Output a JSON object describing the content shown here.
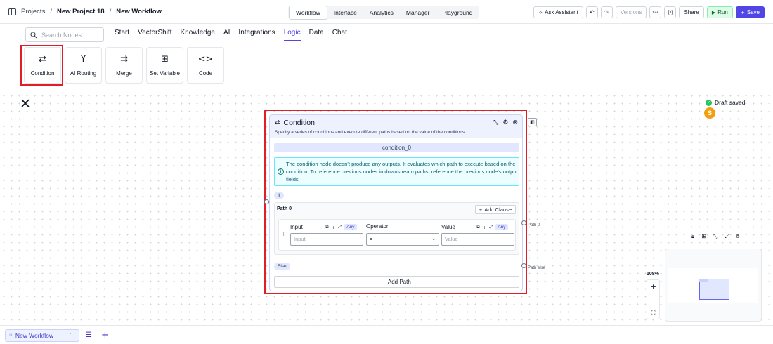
{
  "breadcrumb": {
    "projects": "Projects",
    "project": "New Project 18",
    "workflow": "New Workflow",
    "separator": "/"
  },
  "top_tabs": [
    "Workflow",
    "Interface",
    "Analytics",
    "Manager",
    "Playground"
  ],
  "top_tabs_active": "Workflow",
  "actions": {
    "ask_assistant": "Ask Assistant",
    "undo_glyph": "↶",
    "redo_glyph": "↷",
    "versions": "Versions",
    "code_glyph": "</>",
    "embed_glyph": "[x]",
    "share": "Share",
    "run": "Run",
    "save": "Save"
  },
  "search": {
    "placeholder": "Search Nodes"
  },
  "categories": [
    "Start",
    "VectorShift",
    "Knowledge",
    "AI",
    "Integrations",
    "Logic",
    "Data",
    "Chat"
  ],
  "active_category": "Logic",
  "logic_nodes": [
    {
      "label": "Condition",
      "icon": "condition-icon",
      "glyph": "⇄"
    },
    {
      "label": "AI Routing",
      "icon": "routing-icon",
      "glyph": "Y"
    },
    {
      "label": "Merge",
      "icon": "merge-icon",
      "glyph": "⇉"
    },
    {
      "label": "Set Variable",
      "icon": "set-variable-icon",
      "glyph": "⊞"
    },
    {
      "label": "Code",
      "icon": "code-icon",
      "glyph": "<>"
    }
  ],
  "canvas": {
    "close_glyph": "✕",
    "draft_status": "Draft saved",
    "avatar_initial": "S"
  },
  "node": {
    "title": "Condition",
    "description": "Specify a series of conditions and execute different paths based on the value of the conditions.",
    "name": "condition_0",
    "info": "The condition node doesn't produce any outputs. It evaluates which path to execute based on the condition. To reference previous nodes in downstream paths, reference the previous node's output fields",
    "if_label": "If",
    "path_label": "Path 0",
    "add_clause": "Add Clause",
    "input_label": "Input",
    "input_placeholder": "Input",
    "operator_label": "Operator",
    "operator_value": "=",
    "value_label": "Value",
    "value_placeholder": "Value",
    "any_badge": "Any",
    "else_label": "Else",
    "add_path": "Add Path",
    "handle_path0": "Path 0",
    "handle_else": "Path else"
  },
  "minimap": {
    "zoom": "108%"
  },
  "bottom": {
    "workflow_tab": "New Workflow",
    "menu_glyph": "⋮"
  },
  "colors": {
    "accent": "#4f46e5",
    "highlight": "#e11d25",
    "run_bg": "#dcfce7",
    "info_border": "#67e8f9"
  }
}
